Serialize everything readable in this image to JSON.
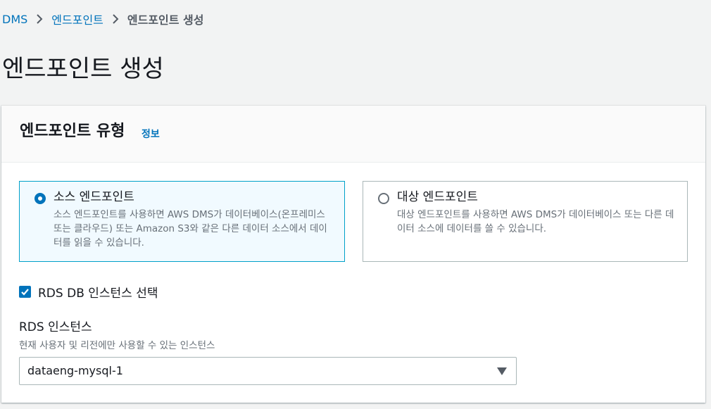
{
  "breadcrumb": {
    "items": [
      {
        "label": "DMS"
      },
      {
        "label": "엔드포인트"
      },
      {
        "label": "엔드포인트 생성"
      }
    ]
  },
  "page": {
    "title": "엔드포인트 생성"
  },
  "endpoint_type": {
    "title": "엔드포인트 유형",
    "info_link": "정보",
    "options": [
      {
        "label": "소스 엔드포인트",
        "description": "소스 엔드포인트를 사용하면 AWS DMS가 데이터베이스(온프레미스 또는 클라우드) 또는 Amazon S3와 같은 다른 데이터 소스에서 데이터를 읽을 수 있습니다.",
        "selected": true
      },
      {
        "label": "대상 엔드포인트",
        "description": "대상 엔드포인트를 사용하면 AWS DMS가 데이터베이스 또는 다른 데이터 소스에 데이터를 쓸 수 있습니다.",
        "selected": false
      }
    ],
    "rds_checkbox": {
      "label": "RDS DB 인스턴스 선택",
      "checked": true
    },
    "rds_instance": {
      "label": "RDS 인스턴스",
      "description": "현재 사용자 및 리전에만 사용할 수 있는 인스턴스",
      "selected_value": "dataeng-mysql-1"
    }
  },
  "colors": {
    "link": "#0073bb",
    "selected_border": "#00a1c9",
    "selected_bg": "#f1faff",
    "page_bg": "#f2f3f3"
  },
  "icons": {
    "breadcrumb_separator": "chevron-right-icon",
    "checkbox": "checkmark-icon",
    "select": "caret-down-icon"
  }
}
